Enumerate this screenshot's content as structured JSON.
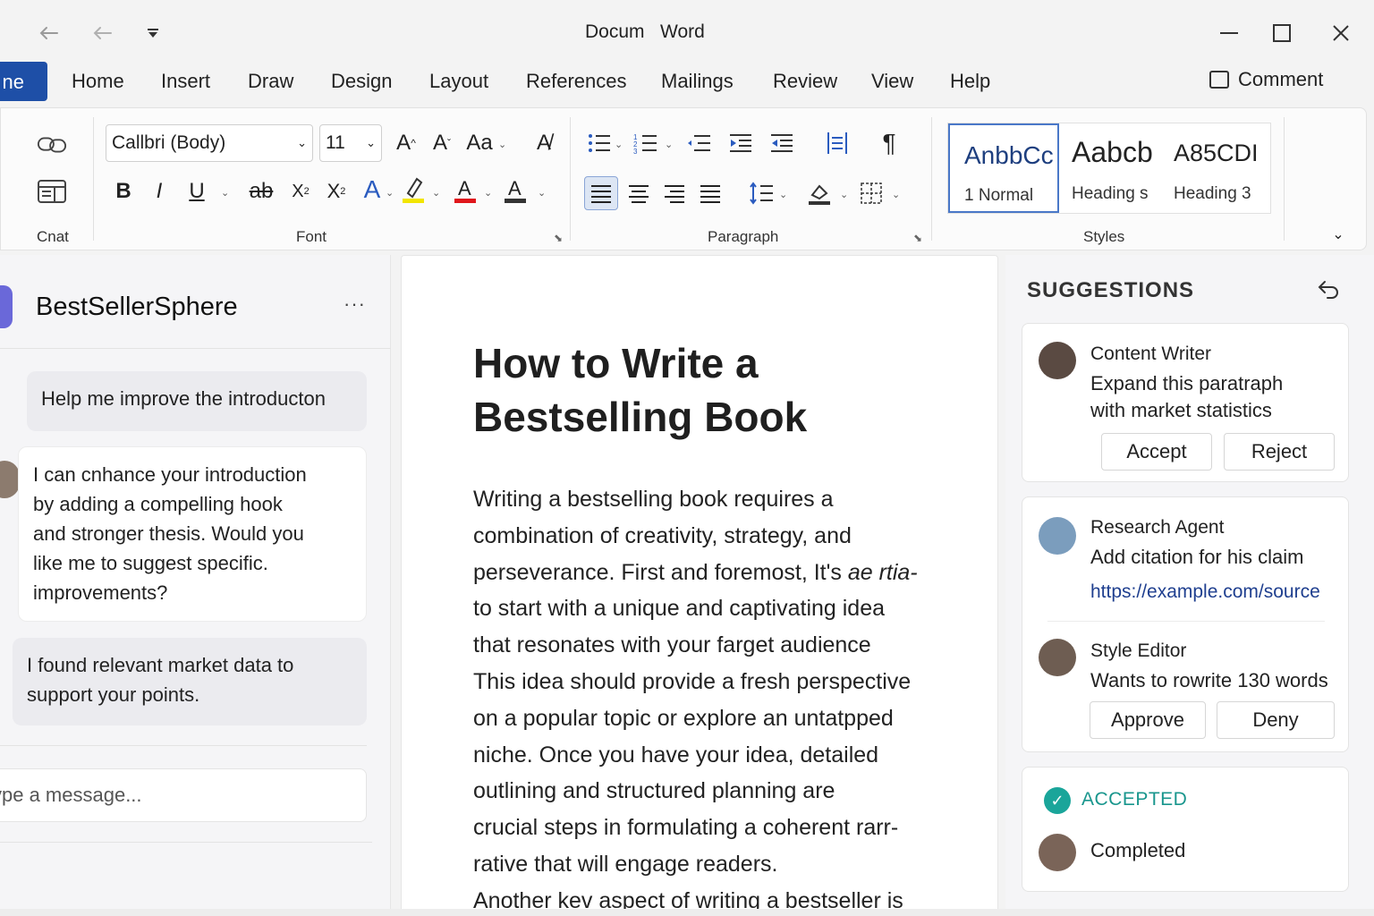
{
  "window": {
    "title": "Docum   Word"
  },
  "titlebar": {
    "undo_icon": "undo-icon",
    "redo_icon": "redo-icon",
    "customize_icon": "customize-qat-icon"
  },
  "menu": {
    "file_label": "ne",
    "tabs": [
      "Home",
      "Insert",
      "Draw",
      "Design",
      "Layout",
      "References",
      "Mailings",
      "Review",
      "View",
      "Help"
    ],
    "comment_label": "Comment"
  },
  "ribbon": {
    "chat_group_label": "Cnat",
    "font_group_label": "Font",
    "paragraph_group_label": "Paragraph",
    "styles_group_label": "Styles",
    "font_name": "Callbri (Body)",
    "font_size": "11",
    "styles": [
      {
        "preview": "AnbbCc",
        "name": "1 Normal"
      },
      {
        "preview": "Aabcb",
        "name": "Heading s"
      },
      {
        "preview": "A85CDI",
        "name": "Heading 3"
      }
    ],
    "accent_color": "#1e4fa7",
    "highlight_color": "#f2e500",
    "font_color": "#e0161b"
  },
  "chat": {
    "title": "BestSellerSphere",
    "messages": [
      {
        "from": "user",
        "text": "Help me improve the introducton"
      },
      {
        "from": "assistant",
        "lines": [
          "I can cnhance your introduction",
          "by adding a compelling hook",
          "and stronger thesis. Would you",
          "like me to suggest specific.",
          "improvements?"
        ]
      },
      {
        "from": "assistant",
        "lines": [
          "I found relevant market data to",
          "support your points."
        ]
      }
    ],
    "input_placeholder": "ype a message..."
  },
  "document": {
    "title_lines": [
      "How to Write a",
      "Bestselling Book"
    ],
    "body_lines": [
      "Writing a bestselling book requires a",
      "combination of creativity, strategy, and",
      "perseverance. First and foremost, It's ",
      "to start with a unique and captivating idea",
      "that resonates with your farget audience",
      "This idea should provide a fresh perspective",
      "on a popular topic or explore an untatpped",
      "niche. Once you have your idea, detailed",
      "outlining and structured planning are",
      "crucial steps in formulating a coherent ",
      "rative that will engage readers.",
      "Another kev aspect of writing a bestseller is"
    ],
    "line3_italic": "ae rtia-",
    "line10_tail": "rarr-"
  },
  "suggestions": {
    "heading": "SUGGESTIONS",
    "cards": [
      {
        "agent": "Content Writer",
        "text_lines": [
          "Expand this paratraph",
          "with market statistics"
        ],
        "accept_label": "Accept",
        "reject_label": "Reject"
      },
      {
        "agent": "Research Agent",
        "text": "Add citation for his claim",
        "link": "https://example.com/source"
      },
      {
        "agent": "Style Editor",
        "text": "Wants to rowrite 130 words",
        "approve_label": "Approve",
        "deny_label": "Deny"
      }
    ],
    "accepted": {
      "label": "ACCEPTED",
      "status": "Completed"
    }
  }
}
